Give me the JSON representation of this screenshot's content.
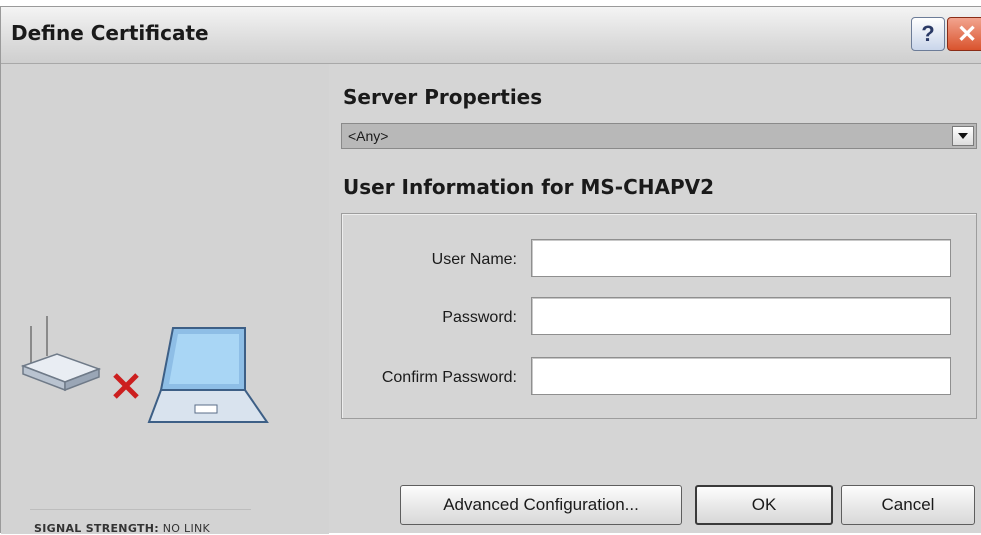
{
  "window": {
    "title": "Define Certificate",
    "help_glyph": "?",
    "close_glyph": "✕"
  },
  "left_panel": {
    "signal_label": "SIGNAL STRENGTH:",
    "signal_value": "NO LINK",
    "icons": [
      "router-icon",
      "no-connection-icon",
      "laptop-icon"
    ]
  },
  "server_properties": {
    "heading": "Server Properties",
    "selected": "<Any>"
  },
  "user_info": {
    "heading": "User Information for MS-CHAPV2",
    "fields": [
      {
        "label": "User Name:",
        "value": ""
      },
      {
        "label": "Password:",
        "value": ""
      },
      {
        "label": "Confirm Password:",
        "value": ""
      }
    ]
  },
  "buttons": {
    "advanced": "Advanced Configuration...",
    "ok": "OK",
    "cancel": "Cancel"
  },
  "colors": {
    "dialog_bg": "#d5d5d5",
    "close_red": "#d9532d",
    "x_mark": "#cc1f1f"
  }
}
